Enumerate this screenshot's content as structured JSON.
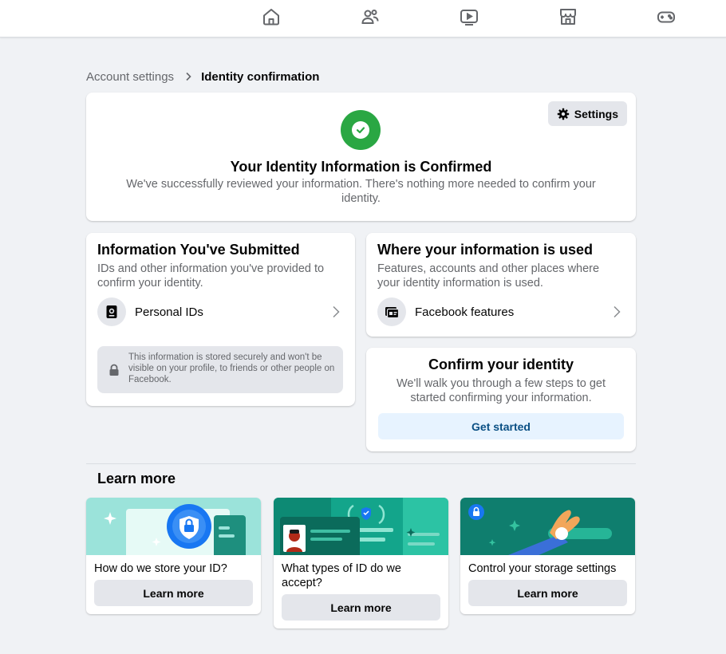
{
  "topnav": {
    "icons": [
      "home-icon",
      "friends-icon",
      "watch-icon",
      "marketplace-icon",
      "gaming-icon"
    ]
  },
  "breadcrumb": {
    "parent": "Account settings",
    "current": "Identity confirmation"
  },
  "hero": {
    "settings_label": "Settings",
    "title": "Your Identity Information is Confirmed",
    "description": "We've successfully reviewed your information. There's nothing more needed to confirm your identity.",
    "status_color": "#2aa743"
  },
  "submitted": {
    "title": "Information You've Submitted",
    "description": "IDs and other information you've provided to confirm your identity.",
    "item_label": "Personal IDs",
    "notice": "This information is stored securely and won't be visible on your profile, to friends or other people on Facebook."
  },
  "where_used": {
    "title": "Where your information is used",
    "description": "Features, accounts and other places where your identity information is used.",
    "item_label": "Facebook features"
  },
  "confirm": {
    "title": "Confirm your identity",
    "description": "We'll walk you through a few steps to get started confirming your information.",
    "button_label": "Get started"
  },
  "learn_more": {
    "heading": "Learn more",
    "cards": [
      {
        "title": "How do we store your ID?",
        "button": "Learn more"
      },
      {
        "title": "What types of ID do we accept?",
        "button": "Learn more"
      },
      {
        "title": "Control your storage settings",
        "button": "Learn more"
      }
    ]
  },
  "colors": {
    "accent_blue": "#1877f2",
    "teal_light": "#9be3da",
    "teal_dark": "#0f7e6e",
    "button_text_blue": "#0a4f84"
  }
}
